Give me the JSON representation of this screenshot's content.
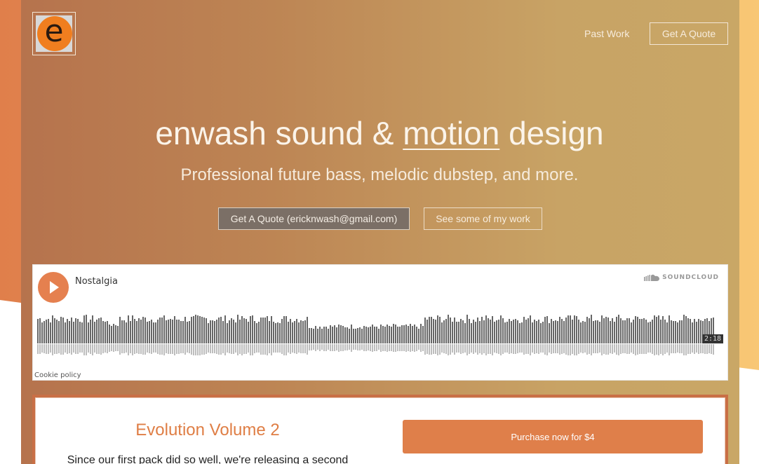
{
  "brand": {
    "logo_letter": "e",
    "accent_color": "#df7e45"
  },
  "nav": {
    "past_work": "Past Work",
    "get_quote": "Get A Quote"
  },
  "hero": {
    "title_before": "enwash sound & ",
    "title_emphasis": "motion",
    "title_after": " design",
    "subtitle": "Professional future bass, melodic dubstep, and more.",
    "cta_quote": "Get A Quote (ericknwash@gmail.com)",
    "cta_work": "See some of my work"
  },
  "soundcloud": {
    "track_title": "Nostalgia",
    "brand_label": "SOUNDCLOUD",
    "duration": "2:18",
    "cookie_policy": "Cookie policy",
    "play_icon": "play-icon",
    "play_color": "#e5804f"
  },
  "product": {
    "title": "Evolution Volume 2",
    "description": "Since our first pack did so well, we're releasing a second",
    "buy_label": "Purchase now for $4"
  }
}
